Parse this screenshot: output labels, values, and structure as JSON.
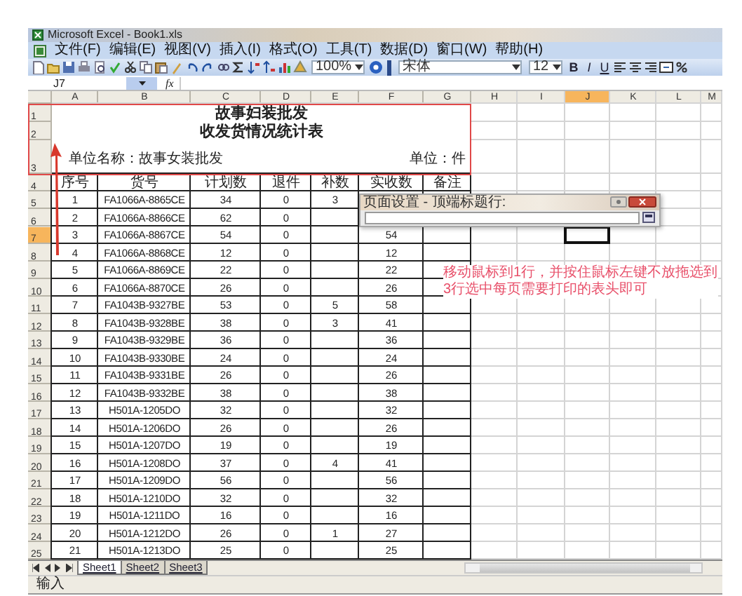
{
  "window": {
    "title": "Microsoft Excel - Book1.xls"
  },
  "menu": [
    "文件(F)",
    "编辑(E)",
    "视图(V)",
    "插入(I)",
    "格式(O)",
    "工具(T)",
    "数据(D)",
    "窗口(W)",
    "帮助(H)"
  ],
  "toolbar": {
    "zoom": "100%",
    "font": "宋体",
    "font_size": "12",
    "format_buttons": [
      "B",
      "I",
      "U"
    ]
  },
  "formula_bar": {
    "name_box": "J7",
    "function_label": "fx"
  },
  "columns": [
    {
      "label": "A",
      "selected": false
    },
    {
      "label": "B",
      "selected": false
    },
    {
      "label": "C",
      "selected": false
    },
    {
      "label": "D",
      "selected": false
    },
    {
      "label": "E",
      "selected": false
    },
    {
      "label": "F",
      "selected": false
    },
    {
      "label": "G",
      "selected": false
    },
    {
      "label": "H",
      "selected": false
    },
    {
      "label": "I",
      "selected": false
    },
    {
      "label": "J",
      "selected": true
    },
    {
      "label": "K",
      "selected": false
    },
    {
      "label": "L",
      "selected": false
    },
    {
      "label": "M",
      "selected": false
    }
  ],
  "row_headers": [
    {
      "label": "1",
      "selected": false
    },
    {
      "label": "2",
      "selected": false
    },
    {
      "label": "3",
      "selected": false
    },
    {
      "label": "4",
      "selected": false
    },
    {
      "label": "5",
      "selected": false
    },
    {
      "label": "6",
      "selected": false
    },
    {
      "label": "7",
      "selected": true
    },
    {
      "label": "8",
      "selected": false
    },
    {
      "label": "9",
      "selected": false
    },
    {
      "label": "10",
      "selected": false
    },
    {
      "label": "11",
      "selected": false
    },
    {
      "label": "12",
      "selected": false
    },
    {
      "label": "13",
      "selected": false
    },
    {
      "label": "14",
      "selected": false
    },
    {
      "label": "15",
      "selected": false
    },
    {
      "label": "16",
      "selected": false
    },
    {
      "label": "17",
      "selected": false
    },
    {
      "label": "18",
      "selected": false
    },
    {
      "label": "19",
      "selected": false
    },
    {
      "label": "20",
      "selected": false
    },
    {
      "label": "21",
      "selected": false
    },
    {
      "label": "22",
      "selected": false
    },
    {
      "label": "23",
      "selected": false
    },
    {
      "label": "24",
      "selected": false
    },
    {
      "label": "25",
      "selected": false
    }
  ],
  "sheet": {
    "title": "故事妇装批发",
    "subtitle": "收发货情况统计表",
    "unit_name": "单位名称：故事女装批发",
    "unit": "单位：件",
    "headers": [
      "序号",
      "货号",
      "计划数",
      "退件",
      "补数",
      "实收数",
      "备注"
    ],
    "rows": [
      {
        "no": "1",
        "item": "FA1066A-8865CE",
        "planned": "34",
        "returned": "0",
        "added": "3"
      },
      {
        "no": "2",
        "item": "FA1066A-8866CE",
        "planned": "62",
        "returned": "0"
      },
      {
        "no": "3",
        "item": "FA1066A-8867CE",
        "planned": "54",
        "returned": "0",
        "received": "54"
      },
      {
        "no": "4",
        "item": "FA1066A-8868CE",
        "planned": "12",
        "returned": "0",
        "received": "12"
      },
      {
        "no": "5",
        "item": "FA1066A-8869CE",
        "planned": "22",
        "returned": "0",
        "received": "22"
      },
      {
        "no": "6",
        "item": "FA1066A-8870CE",
        "planned": "26",
        "returned": "0",
        "received": "26"
      },
      {
        "no": "7",
        "item": "FA1043B-9327BE",
        "planned": "53",
        "returned": "0",
        "added": "5",
        "received": "58"
      },
      {
        "no": "8",
        "item": "FA1043B-9328BE",
        "planned": "38",
        "returned": "0",
        "added": "3",
        "received": "41"
      },
      {
        "no": "9",
        "item": "FA1043B-9329BE",
        "planned": "36",
        "returned": "0",
        "received": "36"
      },
      {
        "no": "10",
        "item": "FA1043B-9330BE",
        "planned": "24",
        "returned": "0",
        "received": "24"
      },
      {
        "no": "11",
        "item": "FA1043B-9331BE",
        "planned": "26",
        "returned": "0",
        "received": "26"
      },
      {
        "no": "12",
        "item": "FA1043B-9332BE",
        "planned": "38",
        "returned": "0",
        "received": "38"
      },
      {
        "no": "13",
        "item": "H501A-1205DO",
        "planned": "32",
        "returned": "0",
        "received": "32"
      },
      {
        "no": "14",
        "item": "H501A-1206DO",
        "planned": "26",
        "returned": "0",
        "received": "26"
      },
      {
        "no": "15",
        "item": "H501A-1207DO",
        "planned": "19",
        "returned": "0",
        "received": "19"
      },
      {
        "no": "16",
        "item": "H501A-1208DO",
        "planned": "37",
        "returned": "0",
        "added": "4",
        "received": "41"
      },
      {
        "no": "17",
        "item": "H501A-1209DO",
        "planned": "56",
        "returned": "0",
        "received": "56"
      },
      {
        "no": "18",
        "item": "H501A-1210DO",
        "planned": "32",
        "returned": "0",
        "received": "32"
      },
      {
        "no": "19",
        "item": "H501A-1211DO",
        "planned": "16",
        "returned": "0",
        "received": "16"
      },
      {
        "no": "20",
        "item": "H501A-1212DO",
        "planned": "26",
        "returned": "0",
        "added": "1",
        "received": "27"
      },
      {
        "no": "21",
        "item": "H501A-1213DO",
        "planned": "25",
        "returned": "0",
        "received": "25"
      }
    ]
  },
  "dialog": {
    "title": "页面设置 - 顶端标题行:"
  },
  "annotation": {
    "lines": [
      "移动鼠标到1行，并按住鼠标左键不放拖选到",
      "3行选中每页需要打印的表头即可"
    ]
  },
  "sheet_tabs": [
    {
      "label": "Sheet1",
      "selected": true
    },
    {
      "label": "Sheet2",
      "selected": false
    },
    {
      "label": "Sheet3",
      "selected": false
    }
  ],
  "status_bar": {
    "text": "输入"
  }
}
